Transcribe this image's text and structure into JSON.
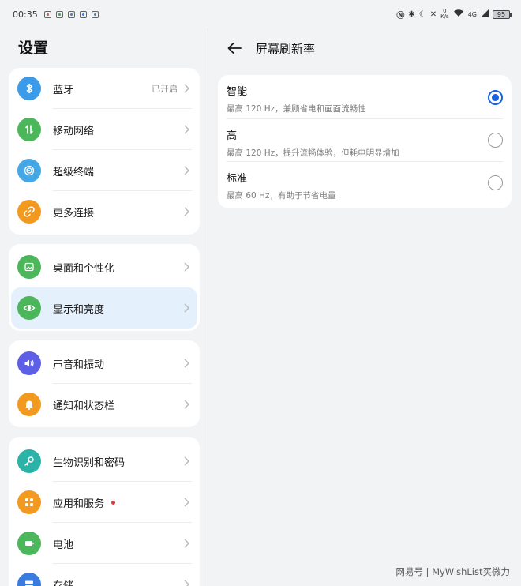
{
  "status_bar": {
    "time": "00:35",
    "battery": "95",
    "network_speed": "0\nK/s",
    "signal_label": "4G",
    "notification_colors": [
      "#e14b3b",
      "#3aa655",
      "#3b7be0",
      "#3b7be0",
      "#3b7be0"
    ]
  },
  "settings": {
    "title": "设置",
    "groups": [
      [
        {
          "label": "蓝牙",
          "value": "已开启",
          "icon": "bluetooth-icon",
          "color": "#3b9be8"
        },
        {
          "label": "移动网络",
          "icon": "mobile-data-icon",
          "color": "#4cb65a"
        },
        {
          "label": "超级终端",
          "icon": "super-device-icon",
          "color": "#44a7e6"
        },
        {
          "label": "更多连接",
          "icon": "link-icon",
          "color": "#f29a1f"
        }
      ],
      [
        {
          "label": "桌面和个性化",
          "icon": "wallpaper-icon",
          "color": "#4cb65a"
        },
        {
          "label": "显示和亮度",
          "icon": "eye-icon",
          "color": "#4cb65a",
          "selected": true
        }
      ],
      [
        {
          "label": "声音和振动",
          "icon": "speaker-icon",
          "color": "#5d5fe6"
        },
        {
          "label": "通知和状态栏",
          "icon": "bell-icon",
          "color": "#f29a1f"
        }
      ],
      [
        {
          "label": "生物识别和密码",
          "icon": "key-icon",
          "color": "#2bb3a8"
        },
        {
          "label": "应用和服务",
          "icon": "apps-icon",
          "color": "#f29a1f",
          "badge": true
        },
        {
          "label": "电池",
          "icon": "battery-icon",
          "color": "#4cb65a"
        },
        {
          "label": "存储",
          "icon": "storage-icon",
          "color": "#3b7be0"
        }
      ]
    ]
  },
  "refresh_rate": {
    "title": "屏幕刷新率",
    "options": [
      {
        "title": "智能",
        "description": "最高 120 Hz，兼顾省电和画面流畅性",
        "checked": true
      },
      {
        "title": "高",
        "description": "最高 120 Hz，提升流畅体验，但耗电明显增加",
        "checked": false
      },
      {
        "title": "标准",
        "description": "最高 60 Hz，有助于节省电量",
        "checked": false
      }
    ]
  },
  "watermark": "网易号 | MyWishList买微力",
  "colors": {
    "accent": "#1763e8",
    "selected_bg": "#e4f0fb",
    "background": "#f1f3f5"
  }
}
